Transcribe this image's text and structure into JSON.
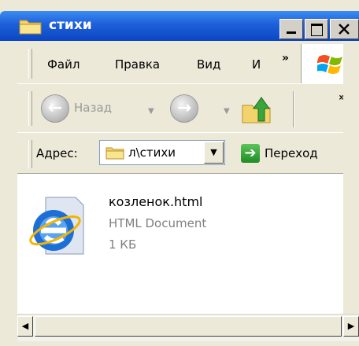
{
  "window": {
    "title": "стихи",
    "folder_icon": "folder-icon",
    "controls": {
      "minimize_icon": "minimize-icon",
      "maximize_icon": "maximize-icon",
      "close_icon": "close-icon"
    }
  },
  "menubar": {
    "items": [
      "Файл",
      "Правка",
      "Вид",
      "И"
    ],
    "overflow": "»",
    "brand_icon": "windows-logo-icon"
  },
  "toolbar": {
    "back_label": "Назад",
    "back_icon": "back-arrow-icon",
    "forward_icon": "forward-arrow-icon",
    "up_icon": "folder-up-icon",
    "overflow": "»"
  },
  "addressbar": {
    "label": "Адрес:",
    "value": "л\\стихи",
    "go_label": "Переход",
    "go_icon": "go-arrow-icon"
  },
  "content": {
    "files": [
      {
        "name": "козленок.html",
        "type": "HTML Document",
        "size": "1 КБ",
        "icon": "ie-document-icon"
      }
    ]
  },
  "colors": {
    "titlebar": "#0b46c4",
    "chrome": "#ece9d8",
    "secondary_text": "#808080"
  }
}
